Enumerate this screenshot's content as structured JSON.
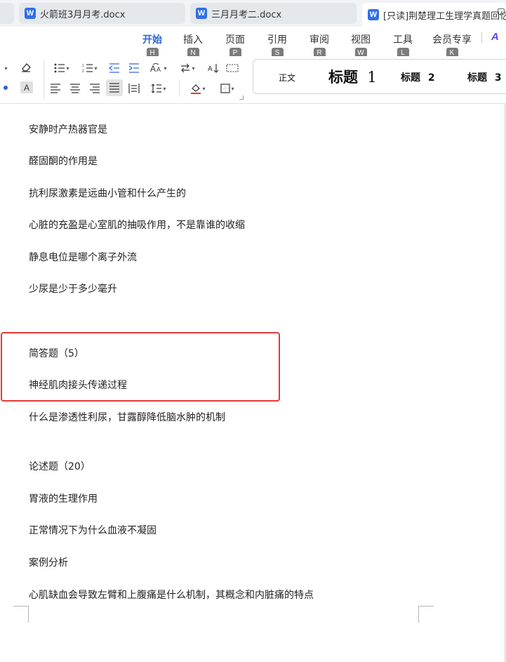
{
  "tabs": [
    {
      "label": "",
      "icon": "doc-tab-partial"
    },
    {
      "label": "火箭班3月月考.docx",
      "icon": "word-icon"
    },
    {
      "label": "三月月考二.docx",
      "icon": "word-icon"
    },
    {
      "label": "[只读]荆楚理工生理学真题回忆",
      "icon": "word-icon",
      "active": true
    }
  ],
  "menu": {
    "items": [
      {
        "label": "开始",
        "key": "H",
        "active": true
      },
      {
        "label": "插入",
        "key": "N"
      },
      {
        "label": "页面",
        "key": "P"
      },
      {
        "label": "引用",
        "key": "S"
      },
      {
        "label": "审阅",
        "key": "R"
      },
      {
        "label": "视图",
        "key": "W"
      },
      {
        "label": "工具",
        "key": "L"
      },
      {
        "label": "会员专享",
        "key": "K"
      }
    ]
  },
  "ribbon": {
    "font_shade_label": "A",
    "styles": {
      "normal": "正文",
      "heading1": "标题",
      "heading1_num": "1",
      "heading2": "标题",
      "heading2_num": "2",
      "heading3": "标题",
      "heading3_num": "3"
    }
  },
  "document": {
    "paragraphs": [
      "安静时产热器官是",
      "醛固酮的作用是",
      "抗利尿激素是远曲小管和什么产生的",
      "心脏的充盈是心室肌的抽吸作用，不是靠谁的收缩",
      "静息电位是哪个离子外流",
      "少尿是少于多少毫升",
      "简答题（5）",
      "神经肌肉接头传递过程",
      "什么是渗透性利尿，甘露醇降低脑水肿的机制",
      "论述题（20）",
      "胃液的生理作用",
      "正常情况下为什么血液不凝固",
      "案例分析",
      "心肌缺血会导致左臂和上腹痛是什么机制，其概念和内脏痛的特点"
    ]
  },
  "colors": {
    "accent": "#2b62d9",
    "highlight_box": "#e53935",
    "word_icon": "#2f6fe8"
  }
}
